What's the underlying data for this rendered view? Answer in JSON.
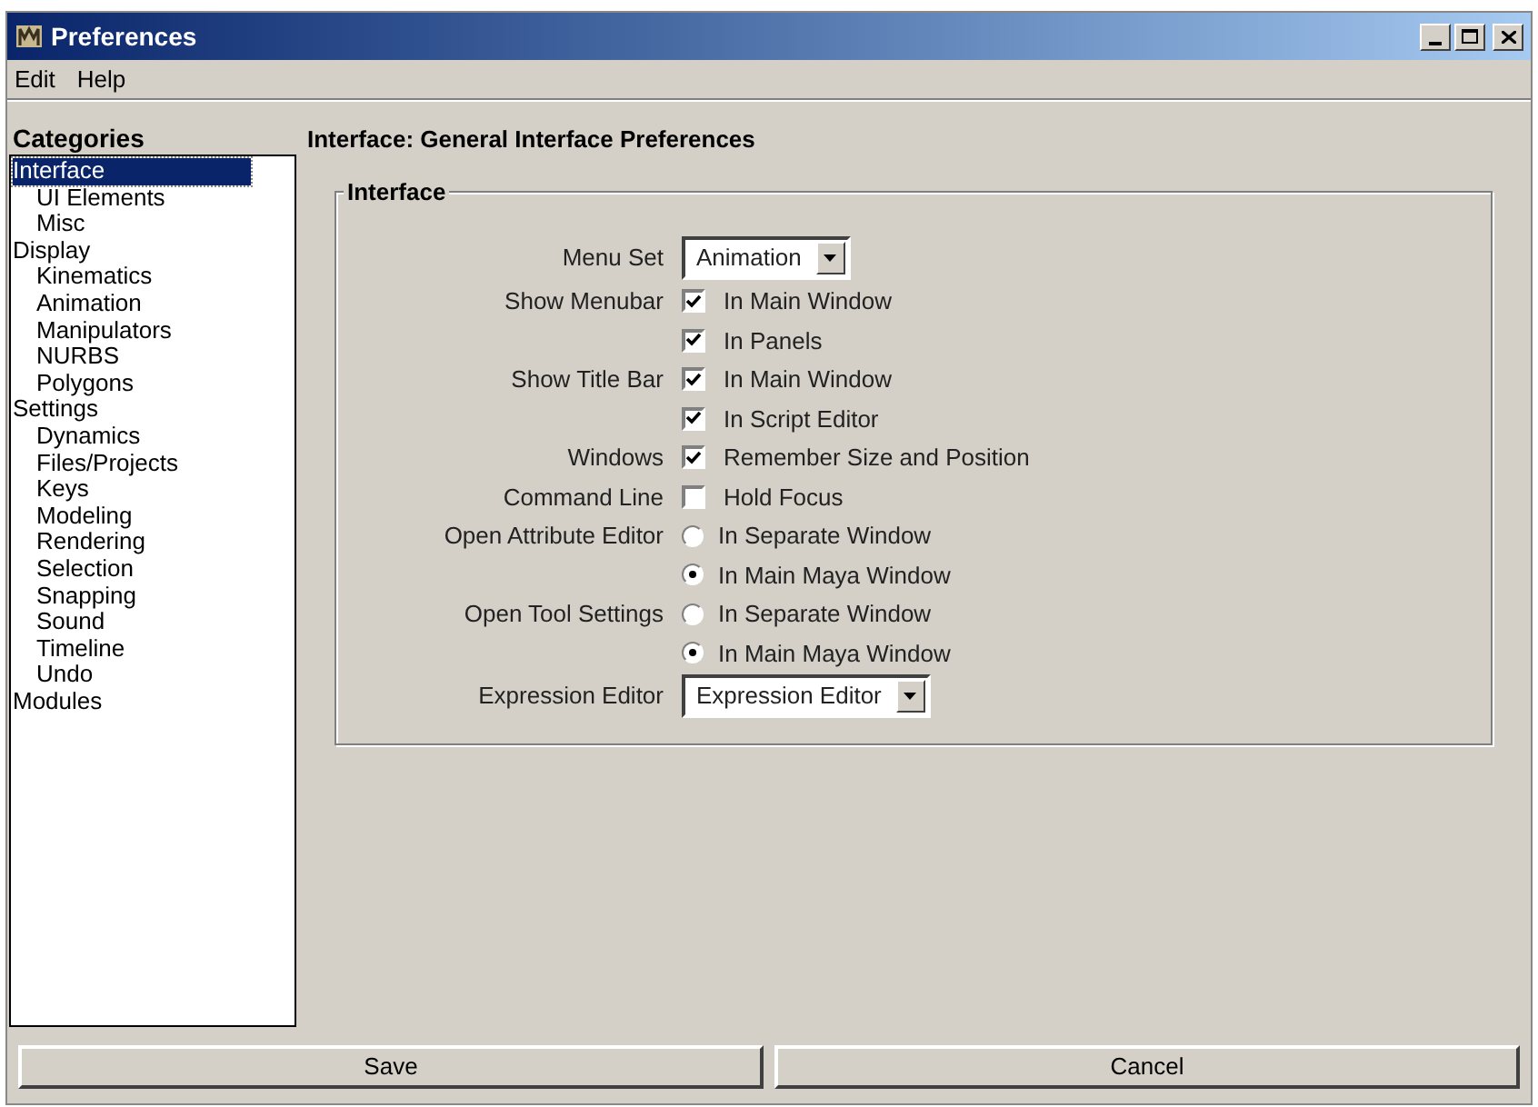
{
  "window": {
    "title": "Preferences"
  },
  "menu": [
    "Edit",
    "Help"
  ],
  "categories": {
    "heading": "Categories",
    "items": [
      {
        "label": "Interface",
        "selected": true,
        "children": [
          {
            "label": "UI Elements",
            "selected": false
          },
          {
            "label": "Misc",
            "selected": false
          }
        ]
      },
      {
        "label": "Display",
        "selected": false,
        "children": [
          {
            "label": "Kinematics",
            "selected": false
          },
          {
            "label": "Animation",
            "selected": false
          },
          {
            "label": "Manipulators",
            "selected": false
          },
          {
            "label": "NURBS",
            "selected": false
          },
          {
            "label": "Polygons",
            "selected": false
          }
        ]
      },
      {
        "label": "Settings",
        "selected": false,
        "children": [
          {
            "label": "Dynamics",
            "selected": false
          },
          {
            "label": "Files/Projects",
            "selected": false
          },
          {
            "label": "Keys",
            "selected": false
          },
          {
            "label": "Modeling",
            "selected": false
          },
          {
            "label": "Rendering",
            "selected": false
          },
          {
            "label": "Selection",
            "selected": false
          },
          {
            "label": "Snapping",
            "selected": false
          },
          {
            "label": "Sound",
            "selected": false
          },
          {
            "label": "Timeline",
            "selected": false
          },
          {
            "label": "Undo",
            "selected": false
          }
        ]
      },
      {
        "label": "Modules",
        "selected": false
      }
    ]
  },
  "panel_title": "Interface: General Interface Preferences",
  "group": {
    "title": "Interface",
    "rows": [
      {
        "label": "Menu Set",
        "kind": "dropdown",
        "value": "Animation"
      },
      {
        "label": "Show Menubar",
        "kind": "checkbox",
        "text": "In Main Window",
        "checked": true
      },
      {
        "kind": "checkbox",
        "text": "In Panels",
        "checked": true
      },
      {
        "label": "Show Title Bar",
        "kind": "checkbox",
        "text": "In Main Window",
        "checked": true
      },
      {
        "kind": "checkbox",
        "text": "In Script Editor",
        "checked": true
      },
      {
        "label": "Windows",
        "kind": "checkbox",
        "text": "Remember Size and Position",
        "checked": true
      },
      {
        "label": "Command Line",
        "kind": "checkbox",
        "text": "Hold Focus",
        "checked": false
      },
      {
        "label": "Open Attribute Editor",
        "kind": "radio",
        "text": "In Separate Window",
        "selected": false
      },
      {
        "kind": "radio",
        "text": "In Main Maya Window",
        "selected": true
      },
      {
        "label": "Open Tool Settings",
        "kind": "radio",
        "text": "In Separate Window",
        "selected": false
      },
      {
        "kind": "radio",
        "text": "In Main Maya Window",
        "selected": true
      },
      {
        "label": "Expression Editor",
        "kind": "dropdown",
        "value": "Expression Editor"
      }
    ]
  },
  "buttons": [
    "Save",
    "Cancel"
  ]
}
